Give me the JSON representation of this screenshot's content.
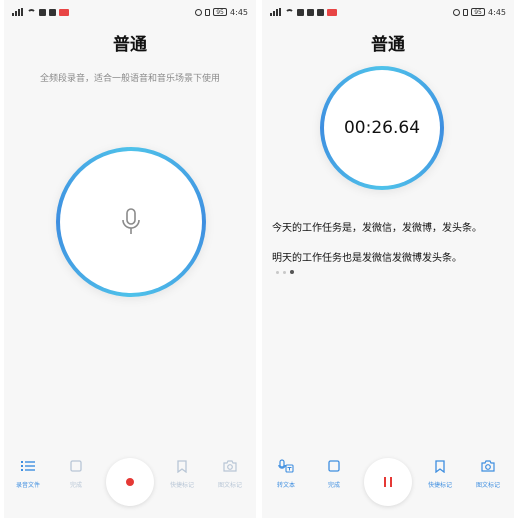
{
  "status": {
    "time": "4:45",
    "battery": "95",
    "signal": "4G"
  },
  "left": {
    "title": "普通",
    "subtitle": "全频段录音，适合一般语音和音乐场景下使用",
    "bottom": [
      {
        "label": "录音文件",
        "icon": "list-icon",
        "state": "active"
      },
      {
        "label": "完成",
        "icon": "stop-icon",
        "state": "disabled"
      },
      {
        "label": "快捷标记",
        "icon": "bookmark-icon",
        "state": "disabled"
      },
      {
        "label": "图文标记",
        "icon": "camera-icon",
        "state": "disabled"
      }
    ],
    "center_icon": "record-icon"
  },
  "right": {
    "title": "普通",
    "timer": "00:26.64",
    "lines": [
      "今天的工作任务是，发微信，发微博，发头条。",
      "明天的工作任务也是发微信发微博发头条。"
    ],
    "bottom": [
      {
        "label": "转文本",
        "icon": "transcribe-icon",
        "state": "active"
      },
      {
        "label": "完成",
        "icon": "stop-icon",
        "state": "active"
      },
      {
        "label": "快捷标记",
        "icon": "bookmark-icon",
        "state": "active"
      },
      {
        "label": "图文标记",
        "icon": "camera-icon",
        "state": "active"
      }
    ],
    "center_icon": "pause-icon"
  },
  "colors": {
    "accent": "#3e8ee0",
    "ring_light": "#4fc2ea",
    "record": "#e53935",
    "disabled": "#b8c6d6",
    "subtitle": "#8b8b8b"
  }
}
